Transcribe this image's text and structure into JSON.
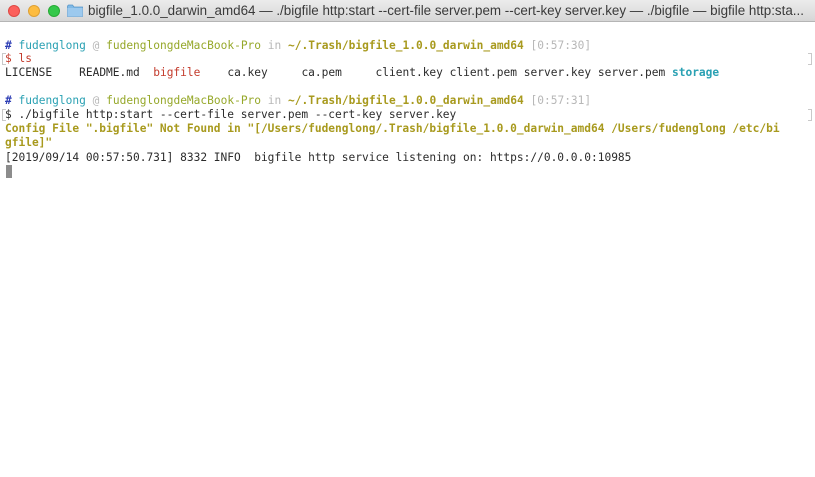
{
  "window": {
    "title": "bigfile_1.0.0_darwin_amd64 — ./bigfile http:start --cert-file server.pem --cert-key server.key — ./bigfile — bigfile http:sta..."
  },
  "icons": {
    "folder": "folder-icon"
  },
  "colors": {
    "prompt_hash": "#2f3fb5",
    "user": "#2aa1b3",
    "host": "#96a82a",
    "path": "#a89a1e",
    "dir_highlight": "#2aa1b3",
    "exec_highlight": "#c33b2c",
    "warning": "#a89a1e"
  },
  "terminal": {
    "prompt1": {
      "hash": "#",
      "user": "fudenglong",
      "at": "@",
      "host": "fudenglongdeMacBook-Pro",
      "in": "in",
      "path": "~/.Trash/bigfile_1.0.0_darwin_amd64",
      "time": "[0:57:30]"
    },
    "command1": "$ ls",
    "ls_output": {
      "license": "LICENSE",
      "readme": "README.md",
      "bigfile": "bigfile",
      "ca_key": "ca.key",
      "ca_pem": "ca.pem",
      "client_key": "client.key",
      "client_pem": "client.pem",
      "server_key": "server.key",
      "server_pem": "server.pem",
      "storage": "storage"
    },
    "prompt2": {
      "hash": "#",
      "user": "fudenglong",
      "at": "@",
      "host": "fudenglongdeMacBook-Pro",
      "in": "in",
      "path": "~/.Trash/bigfile_1.0.0_darwin_amd64",
      "time": "[0:57:31]"
    },
    "command2": "$ ./bigfile http:start --cert-file server.pem --cert-key server.key",
    "warning_line1": "Config File \".bigfile\" Not Found in \"[/Users/fudenglong/.Trash/bigfile_1.0.0_darwin_amd64 /Users/fudenglong /etc/bi",
    "warning_line2": "gfile]\"",
    "log_line": "[2019/09/14 00:57:50.731] 8332 INFO  bigfile http service listening on: https://0.0.0.0:10985"
  }
}
